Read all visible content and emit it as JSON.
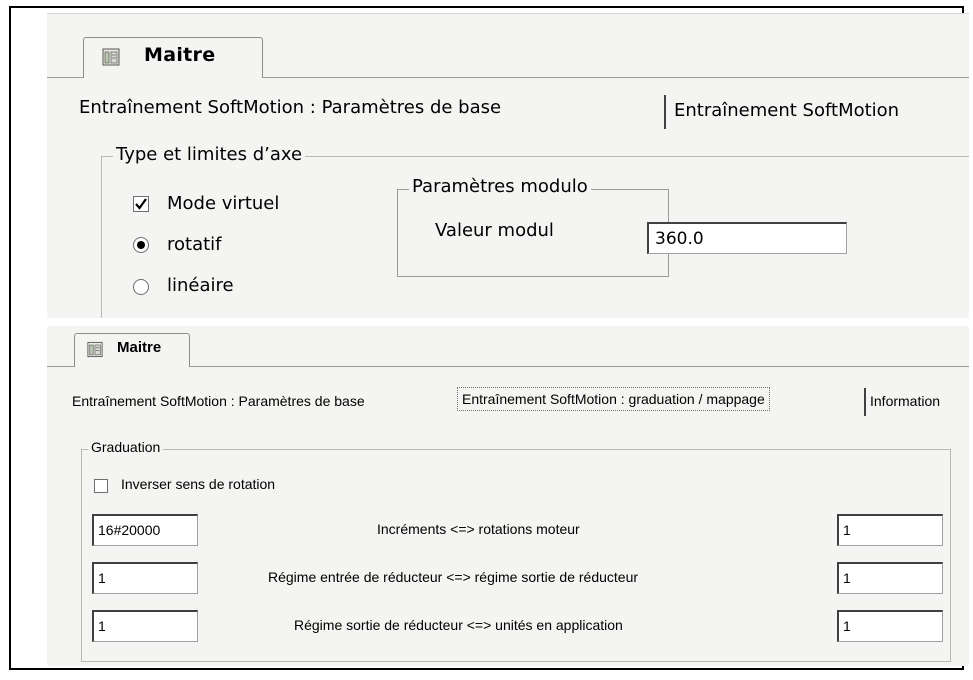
{
  "panel1": {
    "doc_tab_label": "Maitre",
    "sub_tab_active": "Entraînement SoftMotion : Paramètres de base",
    "sub_tab_other": "Entraînement SoftMotion",
    "axis_group": {
      "legend": "Type et limites d’axe",
      "virtual_mode_label": "Mode virtuel",
      "virtual_mode_checked": true,
      "rotary_label": "rotatif",
      "rotary_selected": true,
      "linear_label": "linéaire",
      "linear_selected": false
    },
    "modulo_group": {
      "legend": "Paramètres modulo",
      "value_label": "Valeur modul",
      "value": "360.0"
    }
  },
  "panel2": {
    "doc_tab_label": "Maitre",
    "sub_tabs": [
      "Entraînement SoftMotion : Paramètres de base",
      "Entraînement SoftMotion : graduation / mappage",
      "Information"
    ],
    "graduation": {
      "legend": "Graduation",
      "invert_label": "Inverser sens de rotation",
      "invert_checked": false,
      "rows": [
        {
          "left": "16#20000",
          "label": "Incréments <=> rotations moteur",
          "right": "1"
        },
        {
          "left": "1",
          "label": "Régime entrée de réducteur <=> régime sortie de réducteur",
          "right": "1"
        },
        {
          "left": "1",
          "label": "Régime sortie de réducteur <=> unités en application",
          "right": "1"
        }
      ]
    }
  },
  "icons": {
    "doc_tab_icon": "device-drive-icon",
    "check_icon": "checkmark-icon"
  }
}
